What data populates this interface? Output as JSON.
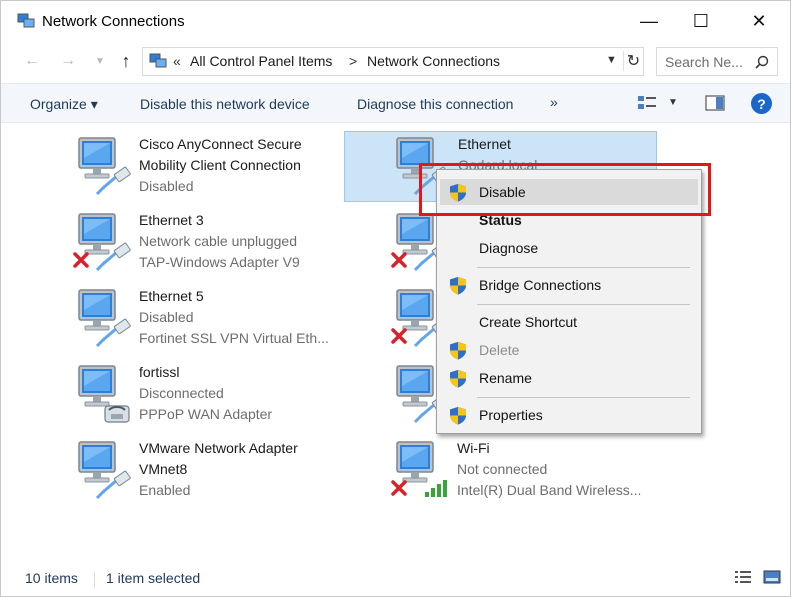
{
  "window": {
    "title": "Network Connections",
    "controls": {
      "minimize": "—",
      "maximize": "☐",
      "close": "✕"
    }
  },
  "address": {
    "chevron": "«",
    "crumbs": [
      "All Control Panel Items",
      "Network Connections"
    ],
    "separator": ">",
    "search_placeholder": "Search Ne..."
  },
  "toolbar": {
    "organize": "Organize ▾",
    "disable": "Disable this network device",
    "diagnose": "Diagnose this connection",
    "more": "»"
  },
  "connections": [
    {
      "name": "Cisco AnyConnect Secure",
      "name2": "Mobility Client Connection",
      "status": "Disabled",
      "adapter": "",
      "state": "disabled"
    },
    {
      "name": "Ethernet",
      "status": "Godard.local",
      "adapter": "",
      "state": "connected",
      "selected": true
    },
    {
      "name": "Ethernet 3",
      "status": "Network cable unplugged",
      "adapter": "TAP-Windows Adapter V9",
      "state": "unplugged"
    },
    {
      "name": "Ethernet 5",
      "status": "Disabled",
      "adapter": "Fortinet SSL VPN Virtual Eth...",
      "state": "disabled"
    },
    {
      "name": "fortissl",
      "status": "Disconnected",
      "adapter": "PPPoP WAN Adapter",
      "state": "dialup"
    },
    {
      "name": "VMware Network Adapter",
      "name2": "VMnet8",
      "status": "Enabled",
      "adapter": "",
      "state": "enabled"
    },
    {
      "name": "Wi-Fi",
      "status": "Not connected",
      "adapter": "Intel(R) Dual Band Wireless...",
      "state": "wifi-disconnected"
    }
  ],
  "context_menu": {
    "items": [
      {
        "label": "Disable",
        "shield": true,
        "hover": true
      },
      {
        "label": "Status",
        "bold": true
      },
      {
        "label": "Diagnose"
      },
      {
        "label": "Bridge Connections",
        "shield": true
      },
      {
        "label": "Create Shortcut"
      },
      {
        "label": "Delete",
        "shield": true,
        "disabled": true
      },
      {
        "label": "Rename",
        "shield": true
      },
      {
        "label": "Properties",
        "shield": true
      }
    ]
  },
  "status_bar": {
    "count": "10 items",
    "selection": "1 item selected"
  },
  "colors": {
    "highlight": "#e3161c",
    "selection": "#cce4f7",
    "toolbar_text": "#1e395b"
  }
}
